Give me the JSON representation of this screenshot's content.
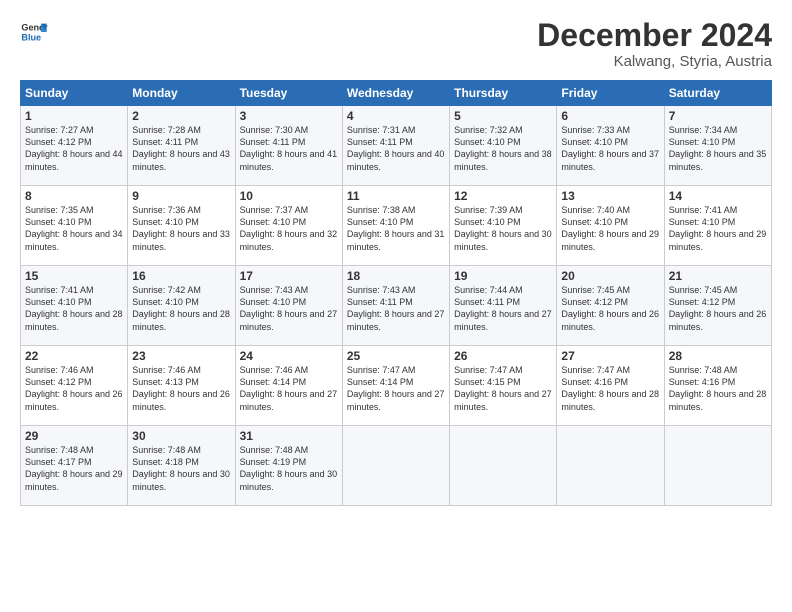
{
  "logo": {
    "line1": "General",
    "line2": "Blue"
  },
  "title": "December 2024",
  "location": "Kalwang, Styria, Austria",
  "days_of_week": [
    "Sunday",
    "Monday",
    "Tuesday",
    "Wednesday",
    "Thursday",
    "Friday",
    "Saturday"
  ],
  "weeks": [
    [
      {
        "day": "1",
        "sunrise": "7:27 AM",
        "sunset": "4:12 PM",
        "daylight": "8 hours and 44 minutes."
      },
      {
        "day": "2",
        "sunrise": "7:28 AM",
        "sunset": "4:11 PM",
        "daylight": "8 hours and 43 minutes."
      },
      {
        "day": "3",
        "sunrise": "7:30 AM",
        "sunset": "4:11 PM",
        "daylight": "8 hours and 41 minutes."
      },
      {
        "day": "4",
        "sunrise": "7:31 AM",
        "sunset": "4:11 PM",
        "daylight": "8 hours and 40 minutes."
      },
      {
        "day": "5",
        "sunrise": "7:32 AM",
        "sunset": "4:10 PM",
        "daylight": "8 hours and 38 minutes."
      },
      {
        "day": "6",
        "sunrise": "7:33 AM",
        "sunset": "4:10 PM",
        "daylight": "8 hours and 37 minutes."
      },
      {
        "day": "7",
        "sunrise": "7:34 AM",
        "sunset": "4:10 PM",
        "daylight": "8 hours and 35 minutes."
      }
    ],
    [
      {
        "day": "8",
        "sunrise": "7:35 AM",
        "sunset": "4:10 PM",
        "daylight": "8 hours and 34 minutes."
      },
      {
        "day": "9",
        "sunrise": "7:36 AM",
        "sunset": "4:10 PM",
        "daylight": "8 hours and 33 minutes."
      },
      {
        "day": "10",
        "sunrise": "7:37 AM",
        "sunset": "4:10 PM",
        "daylight": "8 hours and 32 minutes."
      },
      {
        "day": "11",
        "sunrise": "7:38 AM",
        "sunset": "4:10 PM",
        "daylight": "8 hours and 31 minutes."
      },
      {
        "day": "12",
        "sunrise": "7:39 AM",
        "sunset": "4:10 PM",
        "daylight": "8 hours and 30 minutes."
      },
      {
        "day": "13",
        "sunrise": "7:40 AM",
        "sunset": "4:10 PM",
        "daylight": "8 hours and 29 minutes."
      },
      {
        "day": "14",
        "sunrise": "7:41 AM",
        "sunset": "4:10 PM",
        "daylight": "8 hours and 29 minutes."
      }
    ],
    [
      {
        "day": "15",
        "sunrise": "7:41 AM",
        "sunset": "4:10 PM",
        "daylight": "8 hours and 28 minutes."
      },
      {
        "day": "16",
        "sunrise": "7:42 AM",
        "sunset": "4:10 PM",
        "daylight": "8 hours and 28 minutes."
      },
      {
        "day": "17",
        "sunrise": "7:43 AM",
        "sunset": "4:10 PM",
        "daylight": "8 hours and 27 minutes."
      },
      {
        "day": "18",
        "sunrise": "7:43 AM",
        "sunset": "4:11 PM",
        "daylight": "8 hours and 27 minutes."
      },
      {
        "day": "19",
        "sunrise": "7:44 AM",
        "sunset": "4:11 PM",
        "daylight": "8 hours and 27 minutes."
      },
      {
        "day": "20",
        "sunrise": "7:45 AM",
        "sunset": "4:12 PM",
        "daylight": "8 hours and 26 minutes."
      },
      {
        "day": "21",
        "sunrise": "7:45 AM",
        "sunset": "4:12 PM",
        "daylight": "8 hours and 26 minutes."
      }
    ],
    [
      {
        "day": "22",
        "sunrise": "7:46 AM",
        "sunset": "4:12 PM",
        "daylight": "8 hours and 26 minutes."
      },
      {
        "day": "23",
        "sunrise": "7:46 AM",
        "sunset": "4:13 PM",
        "daylight": "8 hours and 26 minutes."
      },
      {
        "day": "24",
        "sunrise": "7:46 AM",
        "sunset": "4:14 PM",
        "daylight": "8 hours and 27 minutes."
      },
      {
        "day": "25",
        "sunrise": "7:47 AM",
        "sunset": "4:14 PM",
        "daylight": "8 hours and 27 minutes."
      },
      {
        "day": "26",
        "sunrise": "7:47 AM",
        "sunset": "4:15 PM",
        "daylight": "8 hours and 27 minutes."
      },
      {
        "day": "27",
        "sunrise": "7:47 AM",
        "sunset": "4:16 PM",
        "daylight": "8 hours and 28 minutes."
      },
      {
        "day": "28",
        "sunrise": "7:48 AM",
        "sunset": "4:16 PM",
        "daylight": "8 hours and 28 minutes."
      }
    ],
    [
      {
        "day": "29",
        "sunrise": "7:48 AM",
        "sunset": "4:17 PM",
        "daylight": "8 hours and 29 minutes."
      },
      {
        "day": "30",
        "sunrise": "7:48 AM",
        "sunset": "4:18 PM",
        "daylight": "8 hours and 30 minutes."
      },
      {
        "day": "31",
        "sunrise": "7:48 AM",
        "sunset": "4:19 PM",
        "daylight": "8 hours and 30 minutes."
      },
      null,
      null,
      null,
      null
    ]
  ]
}
